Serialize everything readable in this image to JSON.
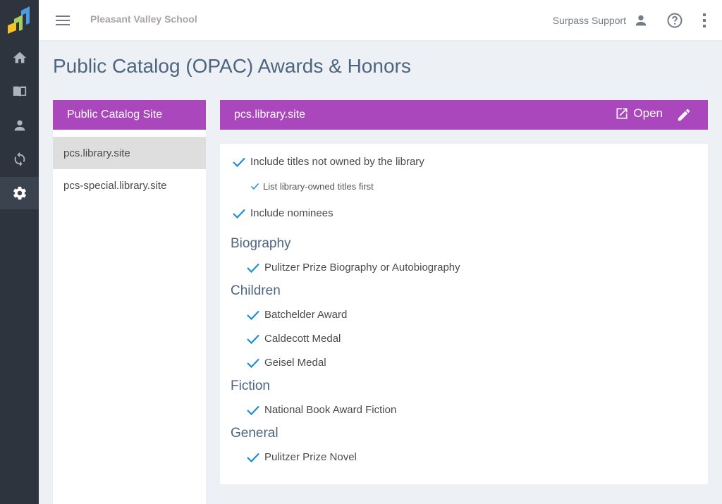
{
  "app": {
    "school_name": "Pleasant Valley School",
    "user_name": "Surpass Support",
    "logo_colors": [
      "#f6c324",
      "#a5cf63",
      "#4a9be0"
    ]
  },
  "rail": {
    "items": [
      {
        "name": "home",
        "icon": "home-icon",
        "active": false
      },
      {
        "name": "catalog",
        "icon": "book-open-icon",
        "active": false
      },
      {
        "name": "patrons",
        "icon": "person-icon",
        "active": false
      },
      {
        "name": "circulation",
        "icon": "sync-icon",
        "active": false
      },
      {
        "name": "settings",
        "icon": "gear-icon",
        "active": true
      }
    ]
  },
  "page": {
    "title": "Public Catalog (OPAC) Awards & Honors"
  },
  "sites_panel": {
    "header": "Public Catalog Site",
    "items": [
      {
        "label": "pcs.library.site",
        "selected": true
      },
      {
        "label": "pcs-special.library.site",
        "selected": false
      }
    ]
  },
  "detail": {
    "header": "pcs.library.site",
    "open_label": "Open",
    "options": [
      {
        "label": "Include titles not owned by the library",
        "checked": true
      },
      {
        "label": "List library-owned titles first",
        "checked": true
      },
      {
        "label": "Include nominees",
        "checked": true
      }
    ],
    "categories": [
      {
        "name": "Biography",
        "awards": [
          "Pulitzer Prize Biography or Autobiography"
        ]
      },
      {
        "name": "Children",
        "awards": [
          "Batchelder Award",
          "Caldecott Medal",
          "Geisel Medal"
        ]
      },
      {
        "name": "Fiction",
        "awards": [
          "National Book Award Fiction"
        ]
      },
      {
        "name": "General",
        "awards": [
          "Pulitzer Prize Novel"
        ]
      }
    ]
  },
  "colors": {
    "accent": "#ab47bc",
    "check": "#1e8fd6",
    "title": "#4e6580",
    "rail": "#2d343d"
  }
}
